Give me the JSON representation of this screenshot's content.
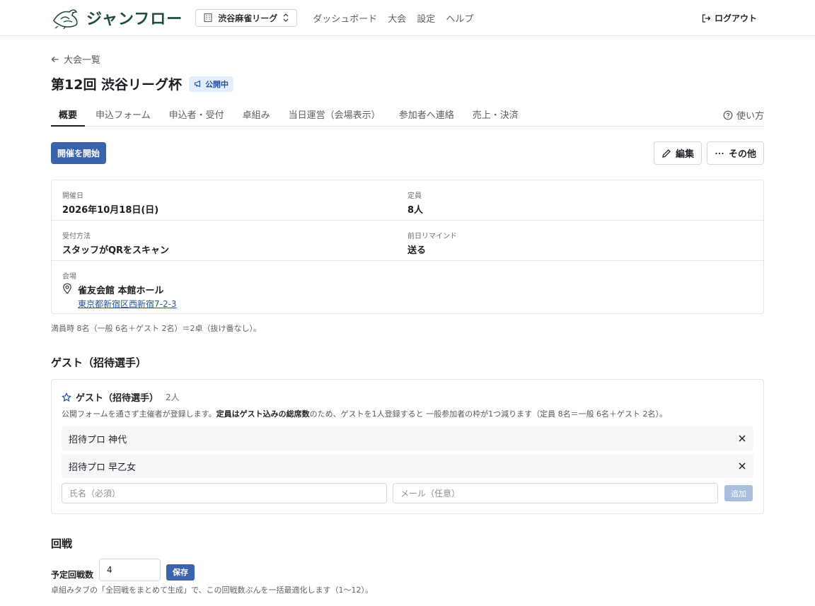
{
  "header": {
    "brand": "ジャンフロー",
    "org": "渋谷麻雀リーグ",
    "nav": [
      "ダッシュボード",
      "大会",
      "設定",
      "ヘルプ"
    ],
    "logout": "ログアウト"
  },
  "back_link": "大会一覧",
  "page": {
    "title": "第12回 渋谷リーグ杯",
    "status": "公開中"
  },
  "tabs": [
    "概要",
    "申込フォーム",
    "申込者・受付",
    "卓組み",
    "当日運営（会場表示）",
    "参加者へ連絡",
    "売上・決済"
  ],
  "help": "使い方",
  "actions": {
    "start": "開催を開始",
    "edit": "編集",
    "more": "その他"
  },
  "info": {
    "date_label": "開催日",
    "date_value": "2026年10月18日(日)",
    "capacity_label": "定員",
    "capacity_value": "8人",
    "checkin_label": "受付方法",
    "checkin_value": "スタッフがQRをスキャン",
    "remind_label": "前日リマインド",
    "remind_value": "送る",
    "venue_label": "会場",
    "venue_name": "雀友会館 本館ホール",
    "venue_address": "東京都新宿区西新宿7-2-3"
  },
  "capacity_note": "満員時 8名（一般 6名＋ゲスト 2名）＝2卓（抜け番なし）。",
  "guests": {
    "section_title": "ゲスト（招待選手）",
    "card_title": "ゲスト（招待選手）",
    "count": "2人",
    "desc_pre": "公開フォームを通さず主催者が登録します。",
    "desc_bold": "定員はゲスト込みの総席数",
    "desc_post": "のため、ゲストを1人登録すると 一般参加者の枠が1つ減ります（定員 8名＝一般 6名＋ゲスト 2名）。",
    "items": [
      "招待プロ 神代",
      "招待プロ 早乙女"
    ],
    "name_placeholder": "氏名（必須）",
    "email_placeholder": "メール（任意）",
    "add_label": "追加"
  },
  "rounds": {
    "section_title": "回戦",
    "label": "予定回戦数",
    "value": "4",
    "save_label": "保存",
    "note": "卓組みタブの「全回戦をまとめて生成」で、この回戦数ぶんを一括最適化します（1〜12）。"
  }
}
